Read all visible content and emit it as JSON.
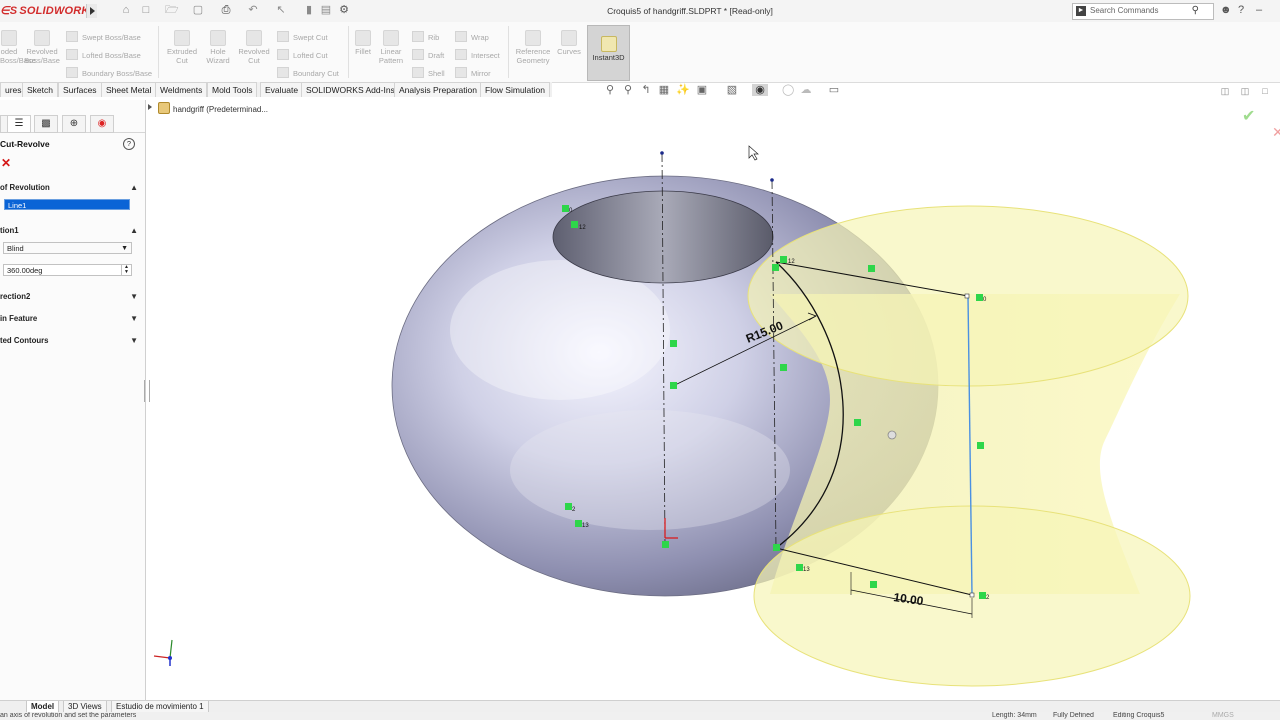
{
  "app": {
    "logo_text": "SOLIDWORKS",
    "window_title": "Croquis5 of handgriff.SLDPRT * [Read-only]"
  },
  "search": {
    "placeholder": "Search Commands"
  },
  "command_manager": {
    "boss_group": [
      "oded Boss/Base",
      "Revolved Boss/Base"
    ],
    "boss_rows": [
      "Swept Boss/Base",
      "Lofted Boss/Base",
      "Boundary Boss/Base"
    ],
    "cut_group": [
      "Extruded Cut",
      "Hole Wizard",
      "Revolved Cut"
    ],
    "cut_rows": [
      "Swept Cut",
      "Lofted Cut",
      "Boundary Cut"
    ],
    "features_group": [
      "Fillet",
      "Linear Pattern"
    ],
    "features_rows_a": [
      "Rib",
      "Draft",
      "Shell"
    ],
    "features_rows_b": [
      "Wrap",
      "Intersect",
      "Mirror"
    ],
    "ref_group": [
      "Reference Geometry",
      "Curves"
    ],
    "instant3d_label": "Instant3D"
  },
  "tabs": [
    "ures",
    "Sketch",
    "Surfaces",
    "Sheet Metal",
    "Weldments",
    "Mold Tools",
    "Evaluate",
    "SOLIDWORKS Add-Ins",
    "Analysis Preparation",
    "Flow Simulation"
  ],
  "feature_tree": {
    "root_label": "handgriff (Predeterminad..."
  },
  "property_manager": {
    "title": "Cut-Revolve",
    "sections": {
      "axis": "of Revolution",
      "axis_value": "Line1",
      "direction1": "tion1",
      "end_condition": "Blind",
      "angle": "360.00deg",
      "direction2": "rection2",
      "thin": "in Feature",
      "contours": "ted Contours"
    }
  },
  "sketch": {
    "dim_radius": "R15.00",
    "dim_length": "10.00",
    "relation_labels": [
      "0",
      "12",
      "12",
      "0",
      "2",
      "13",
      "13",
      "2"
    ]
  },
  "bottom_tabs": [
    "Model",
    "3D Views",
    "Estudio de movimiento 1"
  ],
  "status": {
    "hint": "an axis of revolution and set the parameters",
    "length": "Length: 34mm",
    "defined": "Fully Defined",
    "editing": "Editing Croquis5",
    "units": "MMGS"
  },
  "colors": {
    "accent_red": "#d22c2c",
    "selection_blue": "#0a64d6",
    "preview_yellow": "#f4f2a0",
    "relation_green": "#2ed64a"
  }
}
